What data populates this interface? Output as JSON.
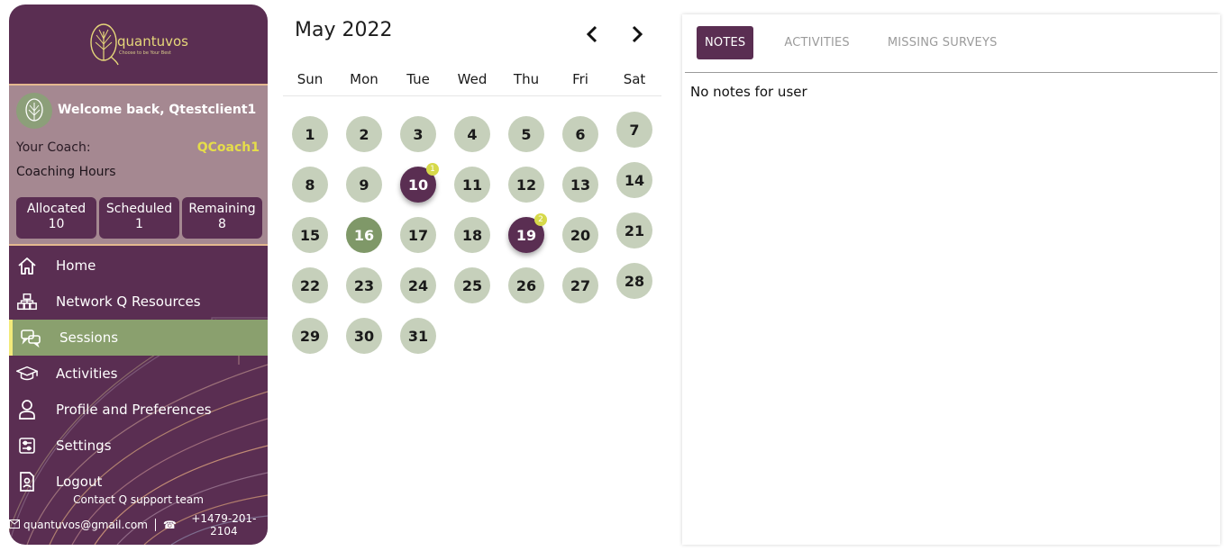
{
  "brand": {
    "name": "quantuvos",
    "tagline": "Choose to be Your Best"
  },
  "profile": {
    "welcome": "Welcome back, Qtestclient1",
    "coach_label": "Your Coach:",
    "coach_name": "QCoach1",
    "hours_label": "Coaching Hours",
    "hours": [
      {
        "label": "Allocated",
        "value": "10"
      },
      {
        "label": "Scheduled",
        "value": "1"
      },
      {
        "label": "Remaining",
        "value": "8"
      }
    ]
  },
  "menu": [
    {
      "label": "Home",
      "icon": "home-icon"
    },
    {
      "label": "Network Q Resources",
      "icon": "network-icon"
    },
    {
      "label": "Sessions",
      "icon": "chat-icon",
      "active": true
    },
    {
      "label": "Activities",
      "icon": "graduation-cap-icon"
    },
    {
      "label": "Profile and Preferences",
      "icon": "user-icon"
    },
    {
      "label": "Settings",
      "icon": "sliders-icon"
    },
    {
      "label": "Logout",
      "icon": "logout-icon"
    }
  ],
  "footer": {
    "contact": "Contact Q support team",
    "email": "quantuvos@gmail.com",
    "phone": "+1479-201-2104"
  },
  "calendar": {
    "title": "May 2022",
    "weekdays": [
      "Sun",
      "Mon",
      "Tue",
      "Wed",
      "Thu",
      "Fri",
      "Sat"
    ],
    "days": [
      "1",
      "2",
      "3",
      "4",
      "5",
      "6",
      "7",
      "8",
      "9",
      "10",
      "11",
      "12",
      "13",
      "14",
      "15",
      "16",
      "17",
      "18",
      "19",
      "20",
      "21",
      "22",
      "23",
      "24",
      "25",
      "26",
      "27",
      "28",
      "29",
      "30",
      "31"
    ],
    "booked": {
      "10": "1",
      "19": "2"
    },
    "today": "16"
  },
  "notes_panel": {
    "tabs": [
      "NOTES",
      "ACTIVITIES",
      "MISSING SURVEYS"
    ],
    "active_tab": "NOTES",
    "empty_message": "No notes for user"
  },
  "colors": {
    "primary": "#5a2e52",
    "accent_green": "#8aa06e",
    "day_bg": "#c6d0bb",
    "highlight": "#e5dd4a"
  }
}
